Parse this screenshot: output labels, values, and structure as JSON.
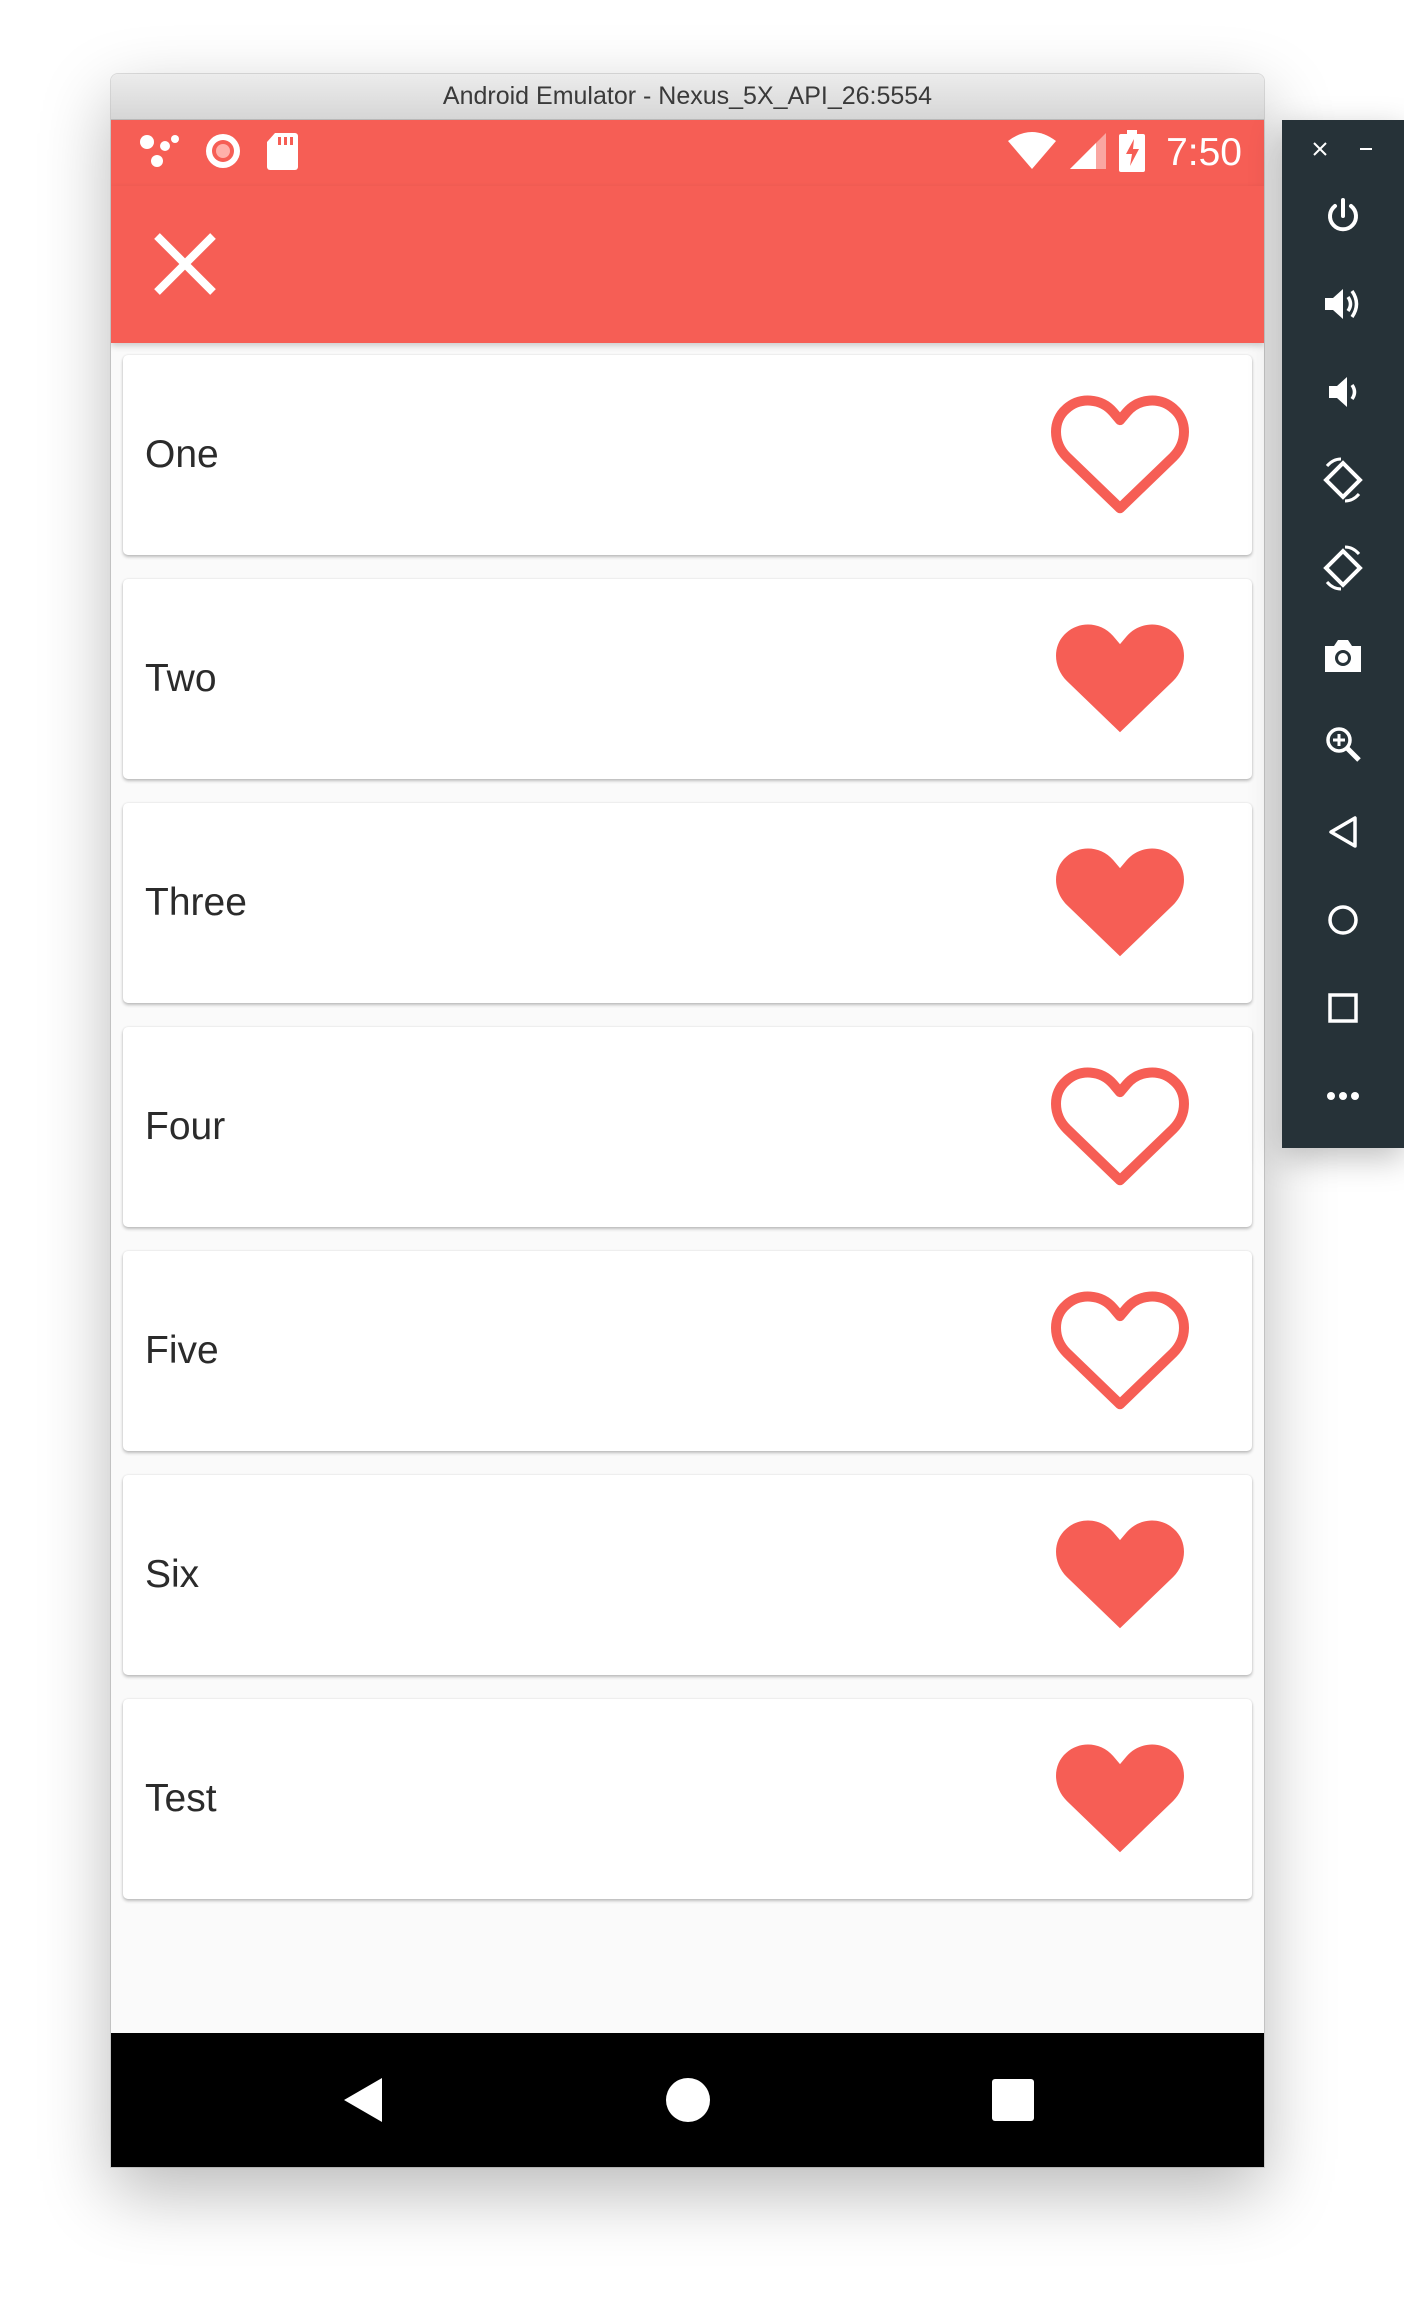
{
  "window": {
    "title": "Android Emulator - Nexus_5X_API_26:5554"
  },
  "statusbar": {
    "time": "7:50",
    "left_icons": [
      "assistant-dots-icon",
      "record-icon",
      "sd-card-icon"
    ],
    "right_icons": [
      "wifi-icon",
      "signal-icon",
      "battery-charging-icon"
    ]
  },
  "appbar": {
    "close_icon": "close-icon"
  },
  "list": {
    "items": [
      {
        "label": "One",
        "favorite": false
      },
      {
        "label": "Two",
        "favorite": true
      },
      {
        "label": "Three",
        "favorite": true
      },
      {
        "label": "Four",
        "favorite": false
      },
      {
        "label": "Five",
        "favorite": false
      },
      {
        "label": "Six",
        "favorite": true
      },
      {
        "label": "Test",
        "favorite": true
      }
    ]
  },
  "navbar": {
    "buttons": [
      "back-icon",
      "home-icon",
      "recents-icon"
    ]
  },
  "toolbar": {
    "buttons": [
      "close-icon",
      "minimize-icon",
      "power-icon",
      "volume-up-icon",
      "volume-down-icon",
      "rotate-left-icon",
      "rotate-right-icon",
      "screenshot-icon",
      "zoom-icon",
      "back-icon",
      "home-icon",
      "overview-icon",
      "more-icon"
    ]
  },
  "colors": {
    "primary": "#f65e55",
    "toolbar_bg": "#263238",
    "text": "#2b2b2b"
  }
}
